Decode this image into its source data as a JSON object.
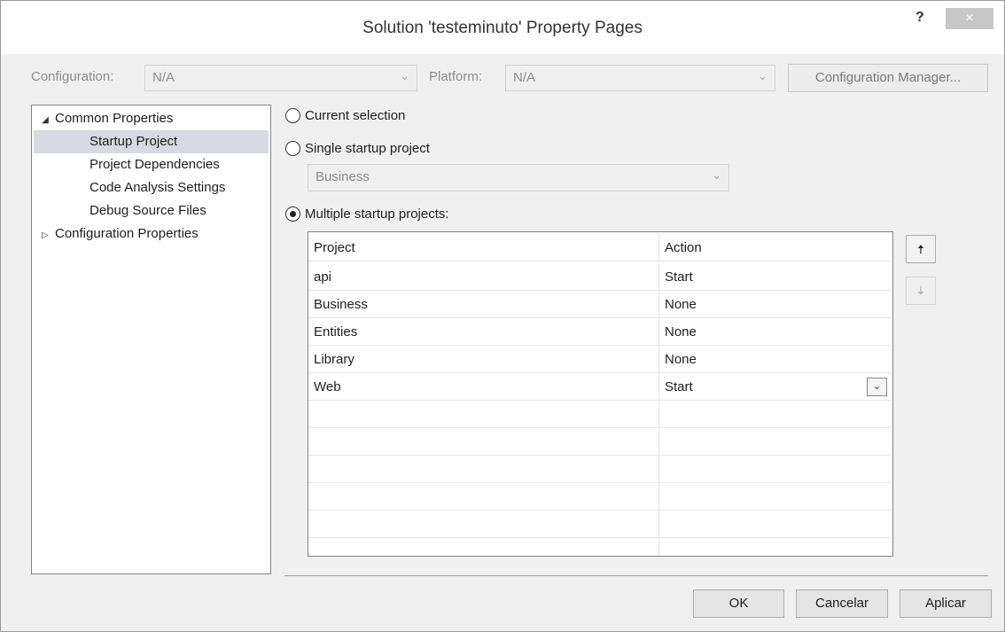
{
  "window": {
    "title": "Solution 'testeminuto' Property Pages",
    "help_label": "?",
    "close_label": "×"
  },
  "config_row": {
    "configuration_label": "Configuration:",
    "configuration_value": "N/A",
    "platform_label": "Platform:",
    "platform_value": "N/A",
    "config_manager_label": "Configuration Manager..."
  },
  "tree": {
    "common_properties": "Common Properties",
    "items": [
      "Startup Project",
      "Project Dependencies",
      "Code Analysis Settings",
      "Debug Source Files"
    ],
    "configuration_properties": "Configuration Properties",
    "expanded_glyph": "◢",
    "collapsed_glyph": "▷"
  },
  "startup": {
    "current_selection": "Current selection",
    "single_startup": "Single startup project",
    "single_value": "Business",
    "multiple_startup": "Multiple startup projects:",
    "selected_option": "multiple"
  },
  "grid": {
    "columns": [
      "Project",
      "Action"
    ],
    "rows": [
      {
        "project": "api",
        "action": "Start"
      },
      {
        "project": "Business",
        "action": "None"
      },
      {
        "project": "Entities",
        "action": "None"
      },
      {
        "project": "Library",
        "action": "None"
      },
      {
        "project": "Web",
        "action": "Start"
      }
    ],
    "dropdown_glyph": "⌄"
  },
  "move": {
    "up_glyph": "🠅",
    "down_glyph": "🠇"
  },
  "buttons": {
    "ok": "OK",
    "cancel": "Cancelar",
    "apply": "Aplicar"
  },
  "colors": {
    "selected_row": "#d9d9e2",
    "dialog_bg": "#f0f0f0",
    "close_button": "#c7c7c7"
  }
}
